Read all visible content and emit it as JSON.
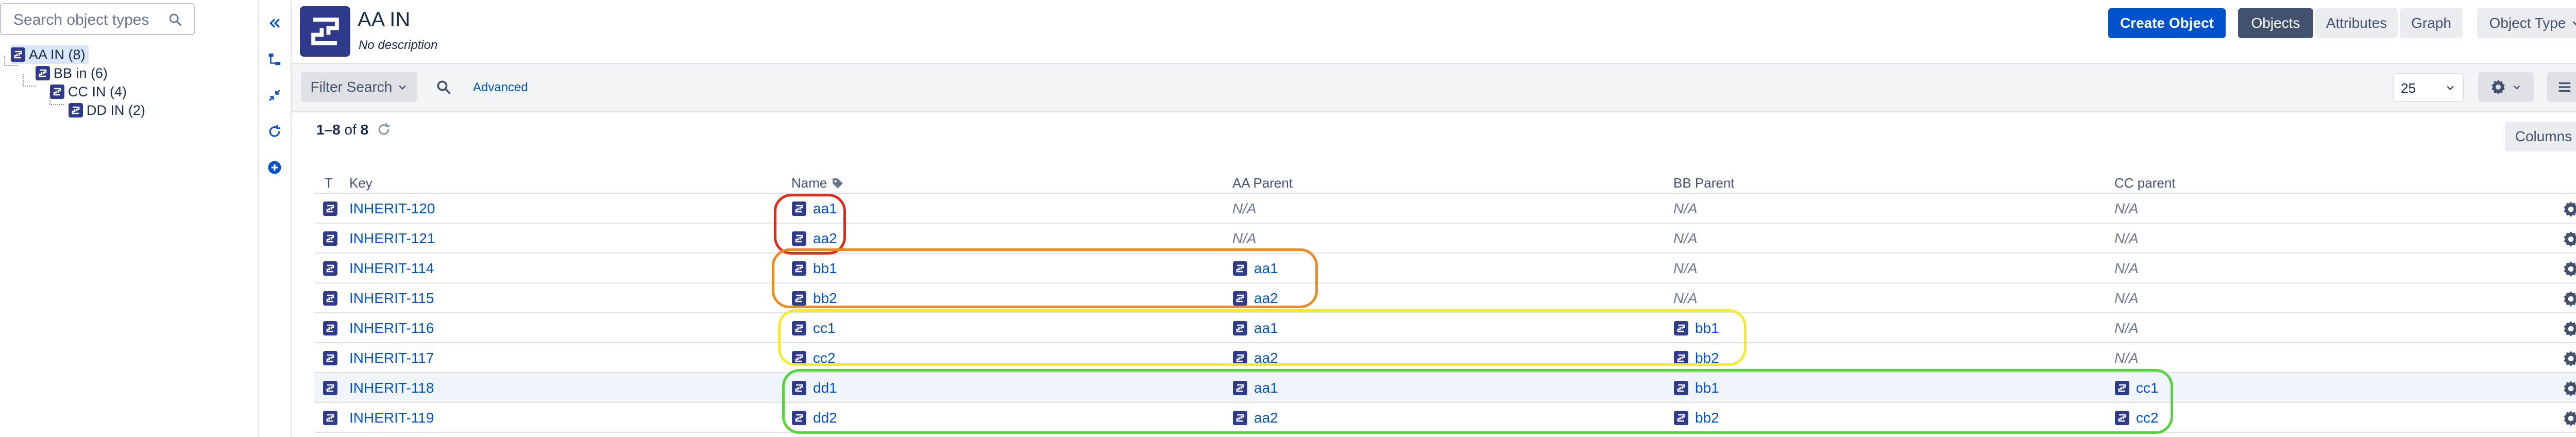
{
  "sidebar": {
    "search_placeholder": "Search object types",
    "tree": [
      {
        "label": "AA IN (8)",
        "selected": true
      },
      {
        "label": "BB in (6)"
      },
      {
        "label": "CC IN (4)"
      },
      {
        "label": "DD IN (2)"
      }
    ]
  },
  "header": {
    "title": "AA IN",
    "description": "No description",
    "create_button": "Create Object",
    "tabs": [
      "Objects",
      "Attributes",
      "Graph"
    ],
    "object_type_button": "Object Type"
  },
  "filter": {
    "filter_button": "Filter Search",
    "advanced_link": "Advanced",
    "page_size": "25"
  },
  "results": {
    "count_range": "1–8",
    "count_of": "of",
    "count_total": "8",
    "columns_button": "Columns"
  },
  "table": {
    "headers": {
      "type": "T",
      "key": "Key",
      "name": "Name",
      "aa_parent": "AA Parent",
      "bb_parent": "BB Parent",
      "cc_parent": "CC parent"
    },
    "rows": [
      {
        "key": "INHERIT-120",
        "name": "aa1",
        "aa": "N/A",
        "bb": "N/A",
        "cc": "N/A"
      },
      {
        "key": "INHERIT-121",
        "name": "aa2",
        "aa": "N/A",
        "bb": "N/A",
        "cc": "N/A"
      },
      {
        "key": "INHERIT-114",
        "name": "bb1",
        "aa": "aa1",
        "bb": "N/A",
        "cc": "N/A"
      },
      {
        "key": "INHERIT-115",
        "name": "bb2",
        "aa": "aa2",
        "bb": "N/A",
        "cc": "N/A"
      },
      {
        "key": "INHERIT-116",
        "name": "cc1",
        "aa": "aa1",
        "bb": "bb1",
        "cc": "N/A"
      },
      {
        "key": "INHERIT-117",
        "name": "cc2",
        "aa": "aa2",
        "bb": "bb2",
        "cc": "N/A"
      },
      {
        "key": "INHERIT-118",
        "name": "dd1",
        "aa": "aa1",
        "bb": "bb1",
        "cc": "cc1"
      },
      {
        "key": "INHERIT-119",
        "name": "dd2",
        "aa": "aa2",
        "bb": "bb2",
        "cc": "cc2"
      }
    ]
  },
  "colors": {
    "primary": "#0052cc",
    "selected_tab": "#42526e",
    "icon_navy": "#2e3a8c",
    "annotation_red": "#e02a1a",
    "annotation_orange": "#ef8a21",
    "annotation_yellow": "#f5ea2e",
    "annotation_green": "#57d33b"
  },
  "icons": [
    "search-icon",
    "object-type-icon",
    "collapse-icon",
    "hierarchy-icon",
    "collapse-arrows-icon",
    "refresh-icon",
    "add-icon",
    "tag-icon",
    "gear-icon",
    "list-icon",
    "chevron-down-icon"
  ]
}
